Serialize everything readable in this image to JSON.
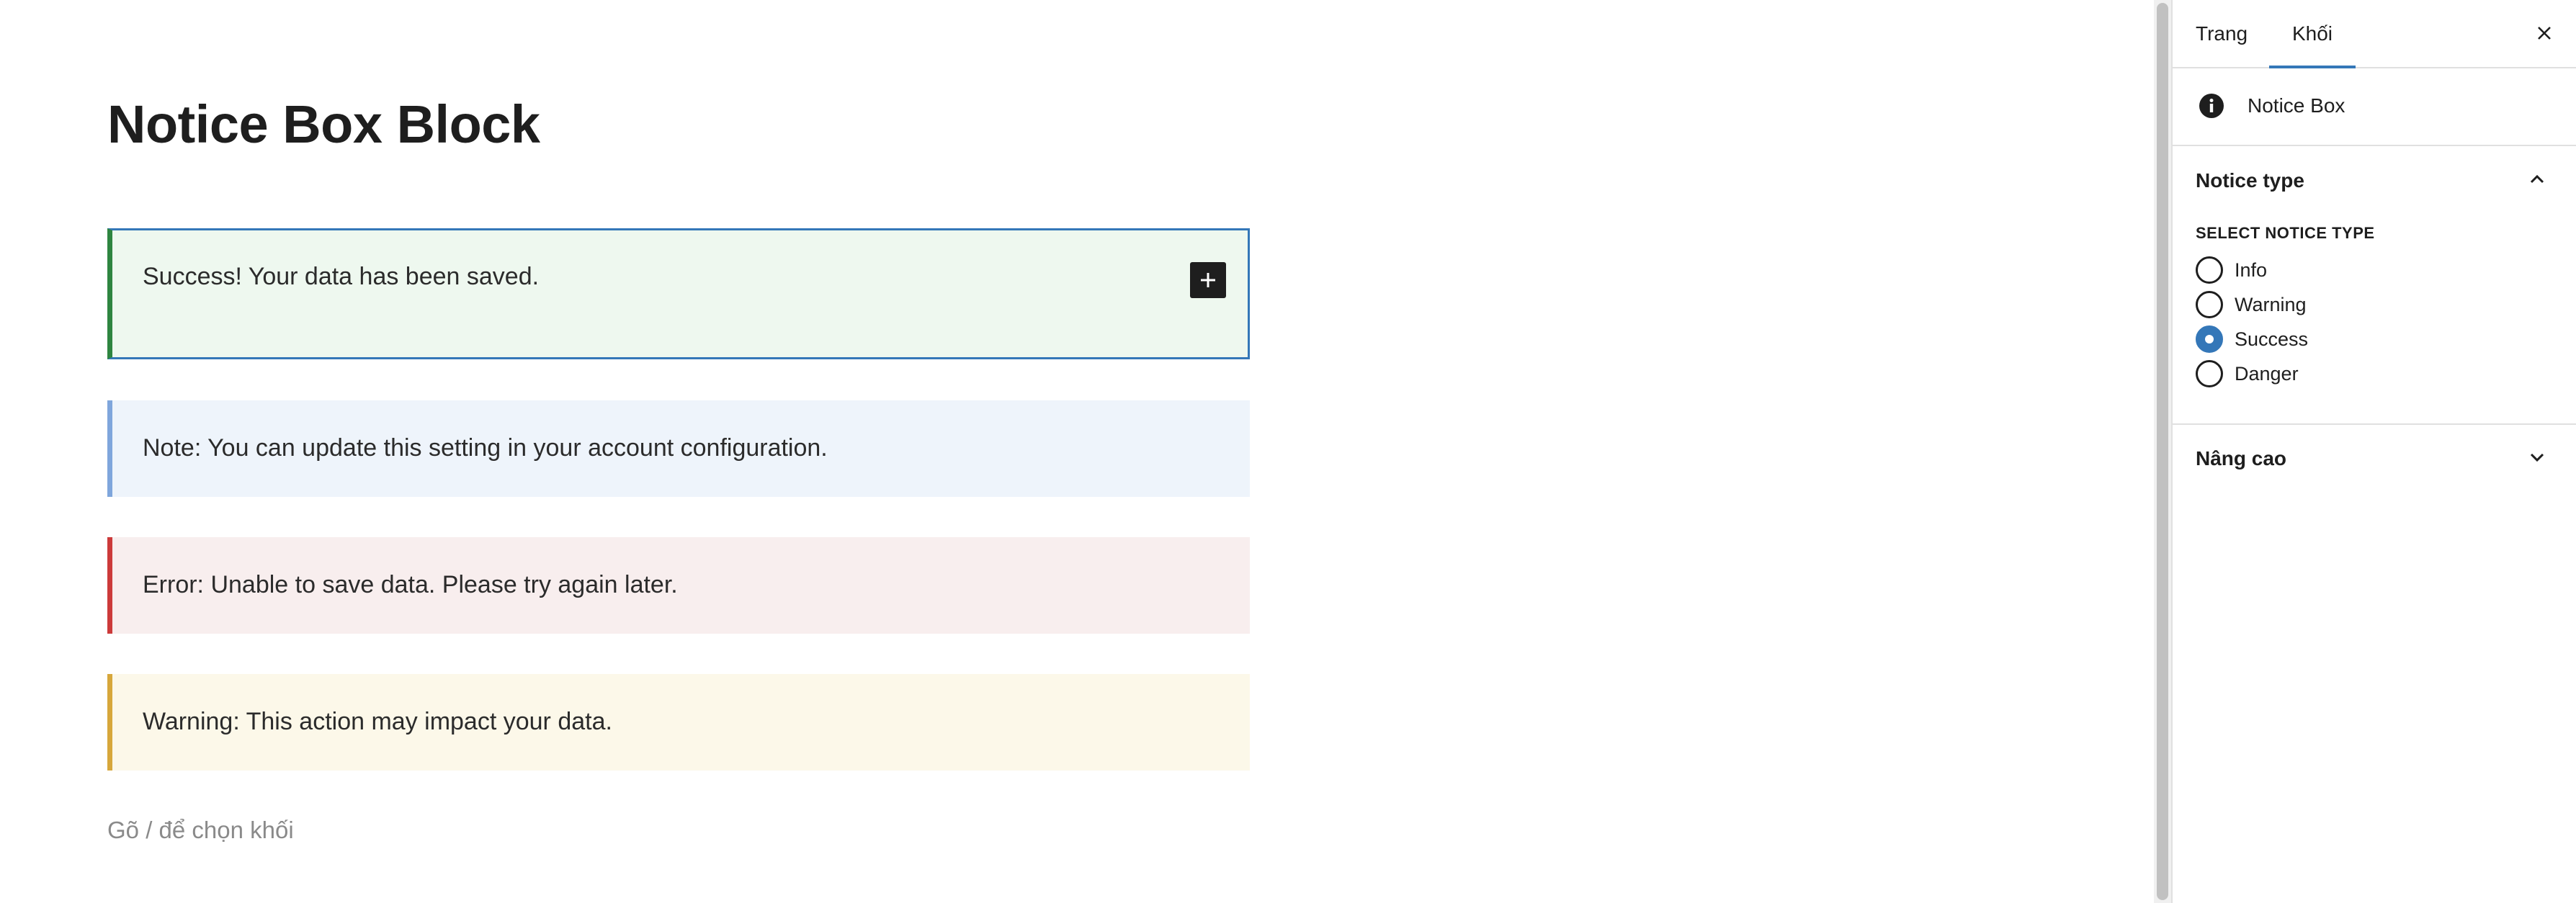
{
  "editor": {
    "title": "Notice Box Block",
    "notices": [
      {
        "type": "success",
        "text": "Success! Your data has been saved."
      },
      {
        "type": "info",
        "text": "Note: You can update this setting in your account configuration."
      },
      {
        "type": "error",
        "text": "Error: Unable to save data. Please try again later."
      },
      {
        "type": "warning",
        "text": "Warning: This action may impact your data."
      }
    ],
    "appender_placeholder": "Gõ / để chọn khối",
    "inserter_icon": "plus-icon"
  },
  "sidebar": {
    "tabs": [
      {
        "label": "Trang",
        "active": false
      },
      {
        "label": "Khối",
        "active": true
      }
    ],
    "close_icon": "close-icon",
    "block_card": {
      "icon": "info-icon",
      "title": "Notice Box"
    },
    "notice_panel": {
      "title": "Notice type",
      "expanded": true,
      "group_label": "SELECT NOTICE TYPE",
      "options": [
        {
          "label": "Info",
          "checked": false
        },
        {
          "label": "Warning",
          "checked": false
        },
        {
          "label": "Success",
          "checked": true
        },
        {
          "label": "Danger",
          "checked": false
        }
      ]
    },
    "advanced_panel": {
      "title": "Nâng cao",
      "expanded": false
    }
  },
  "colors": {
    "accent": "#3477b8",
    "success_border": "#2e8540",
    "success_bg": "#eef8ef",
    "info_border": "#7fa6dc",
    "info_bg": "#eef4fb",
    "error_border": "#cc3a3a",
    "error_bg": "#f8eeee",
    "warning_border": "#d7a73b",
    "warning_bg": "#fcf8e9"
  }
}
